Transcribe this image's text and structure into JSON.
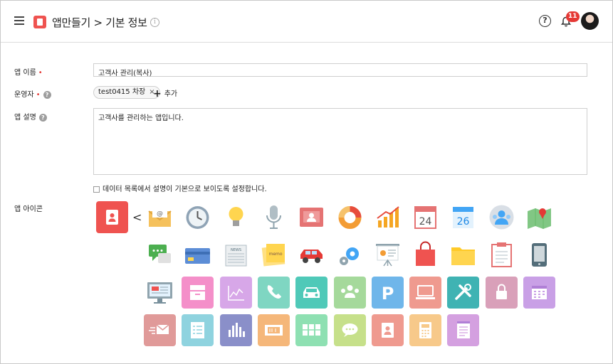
{
  "header": {
    "title": "앱만들기 > 기본 정보",
    "notification_count": "11"
  },
  "form": {
    "app_name": {
      "label": "앱 이름",
      "required_mark": "•",
      "value": "고객사 관리(복사)"
    },
    "operator": {
      "label": "운영자",
      "required_mark": "•",
      "help": "?",
      "tag": "test0415 차장",
      "tag_remove": "×",
      "add_label": "추가",
      "add_plus": "+"
    },
    "description": {
      "label": "앱 설명",
      "help": "?",
      "value": "고객사를 관리하는 앱입니다."
    },
    "checkbox_label": "데이터 목록에서 설명이 기본으로 보이도록 설정합니다.",
    "icon_label": "앱 아이콘"
  },
  "icons": {
    "selected": {
      "name": "contact-book-icon",
      "color": "#ef5350"
    },
    "row1": [
      "envelope-icon",
      "clock-icon",
      "lightbulb-icon",
      "microphone-icon",
      "id-card-icon",
      "donut-chart-icon",
      "bar-growth-icon",
      "calendar-24-icon",
      "calendar-26-icon",
      "users-circle-icon",
      "map-icon"
    ],
    "row2": [
      "chat-bubbles-icon",
      "credit-card-icon",
      "newspaper-icon",
      "memo-note-icon",
      "car-icon",
      "gears-icon",
      "presentation-icon",
      "shopping-bag-icon",
      "folder-icon",
      "clipboard-icon",
      "mobile-icon"
    ],
    "row3": [
      {
        "name": "monitor-icon",
        "color": ""
      },
      {
        "name": "inbox-icon",
        "color": "#f48fc9"
      },
      {
        "name": "line-chart-icon",
        "color": "#d7a7e8"
      },
      {
        "name": "phone-icon",
        "color": "#7fd6c2"
      },
      {
        "name": "car-front-icon",
        "color": "#4fc9b8"
      },
      {
        "name": "group-icon",
        "color": "#a5d99b"
      },
      {
        "name": "parking-icon",
        "color": "#6fb6ea"
      },
      {
        "name": "laptop-icon",
        "color": "#ef9a8f"
      },
      {
        "name": "tools-icon",
        "color": "#3fb3b3"
      },
      {
        "name": "lock-icon",
        "color": "#d9a0b9"
      },
      {
        "name": "calendar-grid-icon",
        "color": "#c9a0e6"
      }
    ],
    "row4": [
      {
        "name": "fast-mail-icon",
        "color": "#e09a99"
      },
      {
        "name": "checklist-icon",
        "color": "#8fd3df"
      },
      {
        "name": "bar-chart-icon",
        "color": "#8a8fc9"
      },
      {
        "name": "ticket-icon",
        "color": "#f5b77a"
      },
      {
        "name": "cabinet-icon",
        "color": "#8ee0b2"
      },
      {
        "name": "speech-bubble-icon",
        "color": "#c6e08a"
      },
      {
        "name": "address-book-icon",
        "color": "#ef9a8f"
      },
      {
        "name": "calculator-icon",
        "color": "#f7c98a"
      },
      {
        "name": "notepad-icon",
        "color": "#d4a0e0"
      }
    ]
  }
}
